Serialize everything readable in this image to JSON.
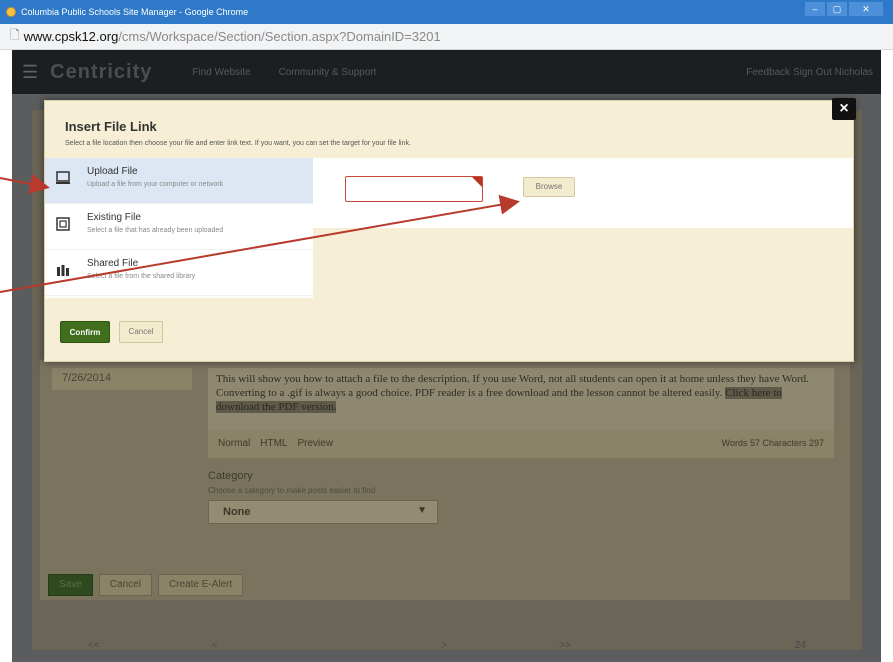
{
  "browser": {
    "window_title": "Columbia Public Schools Site Manager - Google Chrome",
    "address_domain": "www.cpsk12.org",
    "address_path": "/cms/Workspace/Section/Section.aspx?DomainID=3201"
  },
  "app": {
    "brand": "Centricity",
    "nav_items": [
      "Find Website",
      "Community & Support"
    ],
    "nav_right": "Feedback   Sign Out Nicholas",
    "date_tab": "7/26/2014",
    "description_text": "This will show you how to attach a file to the description.  If you use Word, not all students can open it at home unless they have Word.  Converting to a .gif is always a good choice.  PDF reader is a free download and the lesson cannot be altered easily.",
    "description_link": "Click here to download the PDF version.",
    "editor_tabs": [
      "Normal",
      "HTML",
      "Preview"
    ],
    "editor_count": "Words 57 Characters 297",
    "category_label": "Category",
    "category_help": "Choose a category to make posts easier to find",
    "category_value": "None",
    "buttons": [
      "Save",
      "Cancel",
      "Create E-Alert"
    ],
    "pager": [
      "<<",
      "<",
      "",
      ">",
      ">>",
      "",
      "24"
    ]
  },
  "modal": {
    "title": "Insert File Link",
    "instructions": "Select a file location then choose your file and enter link text. If you want, you can set the target for your file link.",
    "close_label": "×",
    "options": [
      {
        "label": "Upload File",
        "description": "Upload a file from your computer or network",
        "icon": "computer-icon",
        "selected": true
      },
      {
        "label": "Existing File",
        "description": "Select a file that has already been uploaded",
        "icon": "file-icon",
        "selected": false
      },
      {
        "label": "Shared File",
        "description": "Select a file from the shared library",
        "icon": "library-icon",
        "selected": false
      }
    ],
    "file_input_value": "",
    "browse_label": "Browse",
    "confirm_label": "Confirm",
    "cancel_label": "Cancel"
  },
  "colors": {
    "selected_option": "#dde6f3",
    "confirm_green": "#3f6e1c",
    "arrow_red": "#b83a2c",
    "modal_bg": "#f6efd6"
  }
}
